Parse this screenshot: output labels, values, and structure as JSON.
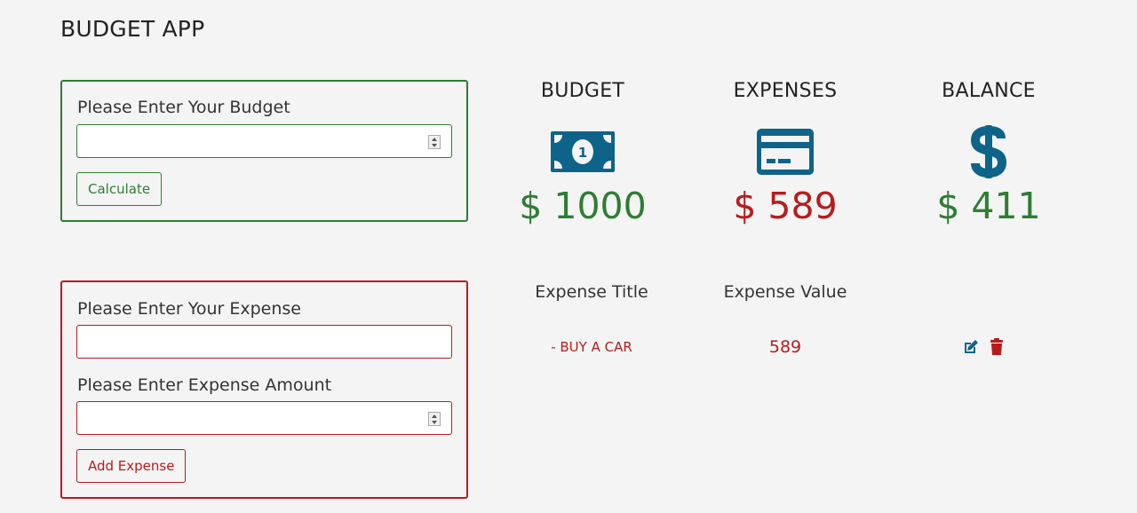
{
  "app": {
    "title": "BUDGET APP"
  },
  "budget_form": {
    "label": "Please Enter Your Budget",
    "input_value": "",
    "button_label": "Calculate"
  },
  "expense_form": {
    "title_label": "Please Enter Your Expense",
    "title_value": "",
    "amount_label": "Please Enter Expense Amount",
    "amount_value": "",
    "button_label": "Add Expense"
  },
  "summary": {
    "budget": {
      "title": "BUDGET",
      "amount": "$ 1000",
      "icon": "money-bill-icon"
    },
    "expenses": {
      "title": "EXPENSES",
      "amount": "$ 589",
      "icon": "credit-card-icon"
    },
    "balance": {
      "title": "BALANCE",
      "amount": "$ 411",
      "icon": "dollar-sign-icon"
    }
  },
  "expense_table": {
    "headers": [
      "Expense Title",
      "Expense Value"
    ],
    "rows": [
      {
        "title": "- BUY A CAR",
        "value": "589"
      }
    ]
  },
  "colors": {
    "green": "#2e7d32",
    "red": "#b71c1c",
    "icon_blue": "#0e6388"
  }
}
